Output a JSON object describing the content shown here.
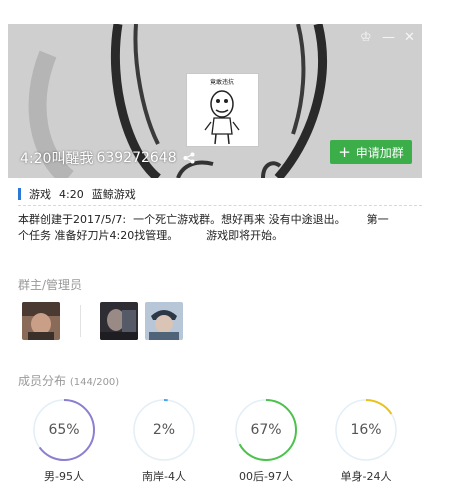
{
  "window": {
    "controls": [
      {
        "name": "skin-icon",
        "glyph": "♔"
      },
      {
        "name": "minimize-icon",
        "glyph": "—"
      },
      {
        "name": "close-icon",
        "glyph": "✕"
      }
    ]
  },
  "banner": {
    "group_name": "4:20叫醒我",
    "group_id": "639272648",
    "avatar_caption": "竟敢违抗",
    "join_button": "申请加群",
    "join_icon": "+"
  },
  "tags": [
    "游戏",
    "4:20",
    "蓝鲸游戏"
  ],
  "description": "本群创建于2017/5/7:  一个死亡游戏群。想好再来 没有中途退出。      第一\n个任务 准备好刀片4:20找管理。        游戏即将开始。",
  "admins": {
    "title": "群主/管理员",
    "owner": [
      {
        "name": "owner-avatar"
      }
    ],
    "managers": [
      {
        "name": "manager-avatar-1"
      },
      {
        "name": "manager-avatar-2"
      }
    ]
  },
  "members": {
    "title": "成员分布",
    "count_text": "(144/200)",
    "stats": [
      {
        "percent_text": "65%",
        "value": 0.65,
        "label": "男-95人",
        "color": "#8b7fd0"
      },
      {
        "percent_text": "2%",
        "value": 0.02,
        "label": "南岸-4人",
        "color": "#4ea4e8"
      },
      {
        "percent_text": "67%",
        "value": 0.67,
        "label": "00后-97人",
        "color": "#4cc24c"
      },
      {
        "percent_text": "16%",
        "value": 0.16,
        "label": "单身-24人",
        "color": "#e8c21a"
      }
    ],
    "track_color": "#e3eef6"
  },
  "colors": {
    "join_button": "#3bae4a",
    "tag_bar": "#2b78d7"
  }
}
